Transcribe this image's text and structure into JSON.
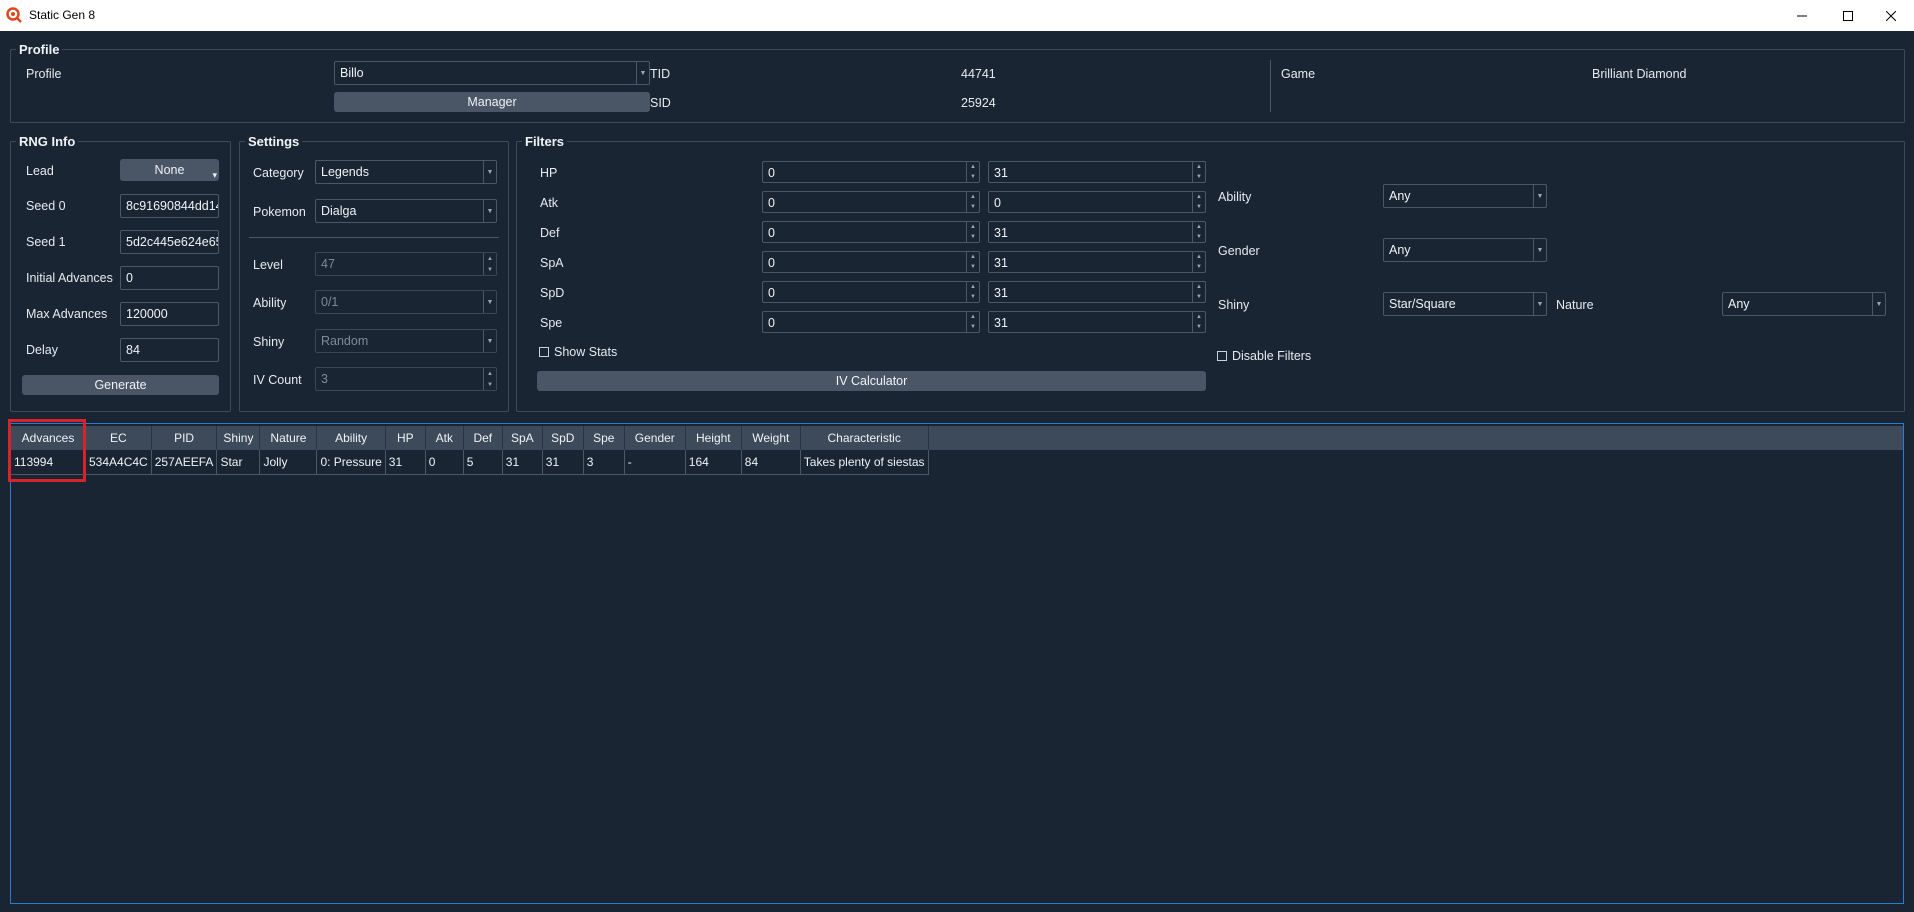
{
  "window": {
    "title": "Static Gen 8"
  },
  "profile": {
    "group_title": "Profile",
    "profile_label": "Profile",
    "profile_value": "Billo",
    "manager_label": "Manager",
    "tid_label": "TID",
    "tid_value": "44741",
    "sid_label": "SID",
    "sid_value": "25924",
    "game_label": "Game",
    "game_value": "Brilliant Diamond"
  },
  "rng_info": {
    "group_title": "RNG Info",
    "lead_label": "Lead",
    "lead_value": "None",
    "seed0_label": "Seed 0",
    "seed0_value": "8c91690844dd14",
    "seed1_label": "Seed 1",
    "seed1_value": "5d2c445e624e65",
    "initial_label": "Initial Advances",
    "initial_value": "0",
    "max_label": "Max Advances",
    "max_value": "120000",
    "delay_label": "Delay",
    "delay_value": "84",
    "generate_label": "Generate"
  },
  "settings": {
    "group_title": "Settings",
    "category_label": "Category",
    "category_value": "Legends",
    "pokemon_label": "Pokemon",
    "pokemon_value": "Dialga",
    "level_label": "Level",
    "level_value": "47",
    "ability_label": "Ability",
    "ability_value": "0/1",
    "shiny_label": "Shiny",
    "shiny_value": "Random",
    "ivcount_label": "IV Count",
    "ivcount_value": "3"
  },
  "filters": {
    "group_title": "Filters",
    "stats": [
      {
        "label": "HP",
        "min": "0",
        "max": "31"
      },
      {
        "label": "Atk",
        "min": "0",
        "max": "0"
      },
      {
        "label": "Def",
        "min": "0",
        "max": "31"
      },
      {
        "label": "SpA",
        "min": "0",
        "max": "31"
      },
      {
        "label": "SpD",
        "min": "0",
        "max": "31"
      },
      {
        "label": "Spe",
        "min": "0",
        "max": "31"
      }
    ],
    "show_stats_label": "Show Stats",
    "iv_calculator_label": "IV Calculator",
    "ability_label": "Ability",
    "ability_value": "Any",
    "gender_label": "Gender",
    "gender_value": "Any",
    "shiny_label": "Shiny",
    "shiny_value": "Star/Square",
    "nature_label": "Nature",
    "nature_value": "Any",
    "disable_filters_label": "Disable Filters"
  },
  "results": {
    "columns": [
      "Advances",
      "EC",
      "PID",
      "Shiny",
      "Nature",
      "Ability",
      "HP",
      "Atk",
      "Def",
      "SpA",
      "SpD",
      "Spe",
      "Gender",
      "Height",
      "Weight",
      "Characteristic"
    ],
    "rows": [
      [
        "113994",
        "534A4C4C",
        "257AEEFA",
        "Star",
        "Jolly",
        "0: Pressure",
        "31",
        "0",
        "5",
        "31",
        "31",
        "3",
        "-",
        "164",
        "84",
        "Takes plenty of siestas"
      ]
    ]
  },
  "colors": {
    "background": "#1a2533",
    "accent": "#2f7ad1",
    "highlight": "#d8232a"
  }
}
